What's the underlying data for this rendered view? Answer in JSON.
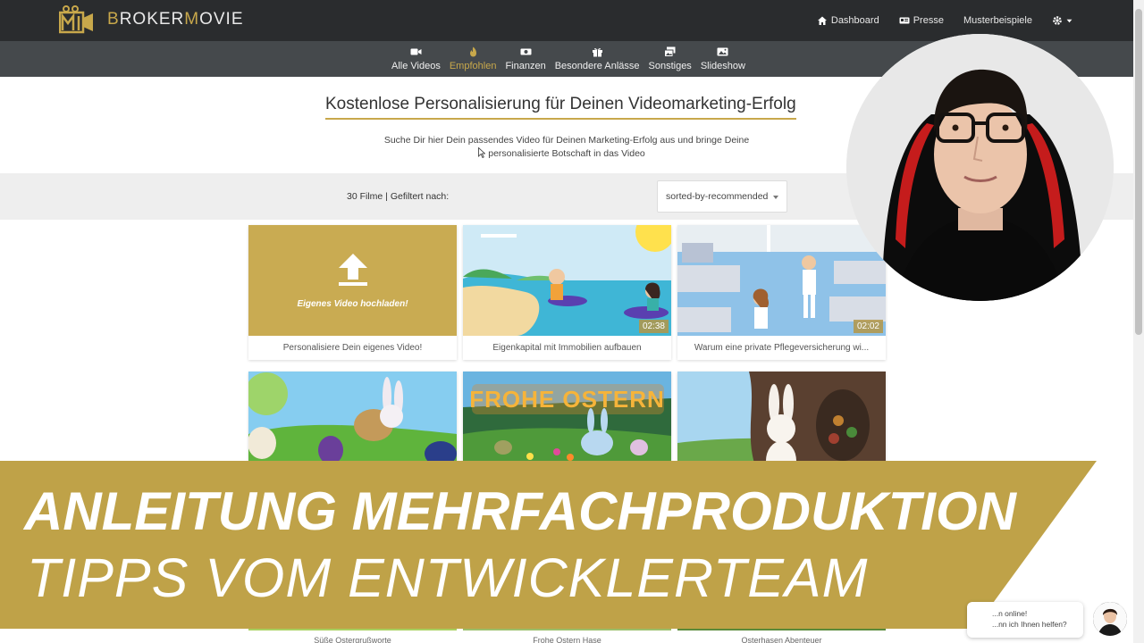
{
  "header": {
    "logo_prefix": "B",
    "logo_middle": "ROKER",
    "logo_m": "M",
    "logo_suffix": "OVIE",
    "nav": [
      {
        "label": "Dashboard",
        "icon": "home-icon"
      },
      {
        "label": "Presse",
        "icon": "newspaper-icon"
      },
      {
        "label": "Musterbeispiele",
        "icon": ""
      }
    ]
  },
  "categories": [
    {
      "label": "Alle Videos",
      "icon": "video-camera-icon",
      "active": false
    },
    {
      "label": "Empfohlen",
      "icon": "fire-icon",
      "active": true
    },
    {
      "label": "Finanzen",
      "icon": "money-icon",
      "active": false
    },
    {
      "label": "Besondere Anlässe",
      "icon": "gift-icon",
      "active": false
    },
    {
      "label": "Sonstiges",
      "icon": "images-icon",
      "active": false
    },
    {
      "label": "Slideshow",
      "icon": "picture-icon",
      "active": false
    }
  ],
  "hero": {
    "title": "Kostenlose Personalisierung für Deinen Videomarketing-Erfolg",
    "subtitle_line1": "Suche Dir hier Dein passendes Video für Deinen Marketing-Erfolg aus und bringe Deine",
    "subtitle_line2": "personalisierte Botschaft in das Video"
  },
  "filter": {
    "count_text": "30 Filme | Gefiltert nach:",
    "sort_value": "sorted-by-recommended"
  },
  "cards": [
    {
      "title": "Personalisiere Dein eigenes Video!",
      "thumb_label": "Eigenes Video hochladen!",
      "duration": ""
    },
    {
      "title": "Eigenkapital mit Immobilien aufbauen",
      "duration": "02:38"
    },
    {
      "title": "Warum eine private Pflegeversicherung wi...",
      "duration": "02:02"
    },
    {
      "title": "",
      "duration": ""
    },
    {
      "title": "",
      "thumb_text": "FROHE OSTERN",
      "duration": ""
    },
    {
      "title": "",
      "duration": ""
    }
  ],
  "bottom_cards": [
    {
      "title": "Süße Ostergrußworte"
    },
    {
      "title": "Frohe Ostern Hase"
    },
    {
      "title": "Osterhasen Abenteuer"
    }
  ],
  "banner": {
    "title": "ANLEITUNG MEHRFACHPRODUKTION",
    "subtitle": "TIPPS VOM ENTWICKLERTEAM",
    "color": "#bfa248"
  },
  "chat": {
    "line1": "...n online!",
    "line2": "...nn ich Ihnen helfen?"
  },
  "colors": {
    "gold": "#c8a84b",
    "header_bg": "#2a2c2e",
    "category_bg": "#45494c"
  }
}
